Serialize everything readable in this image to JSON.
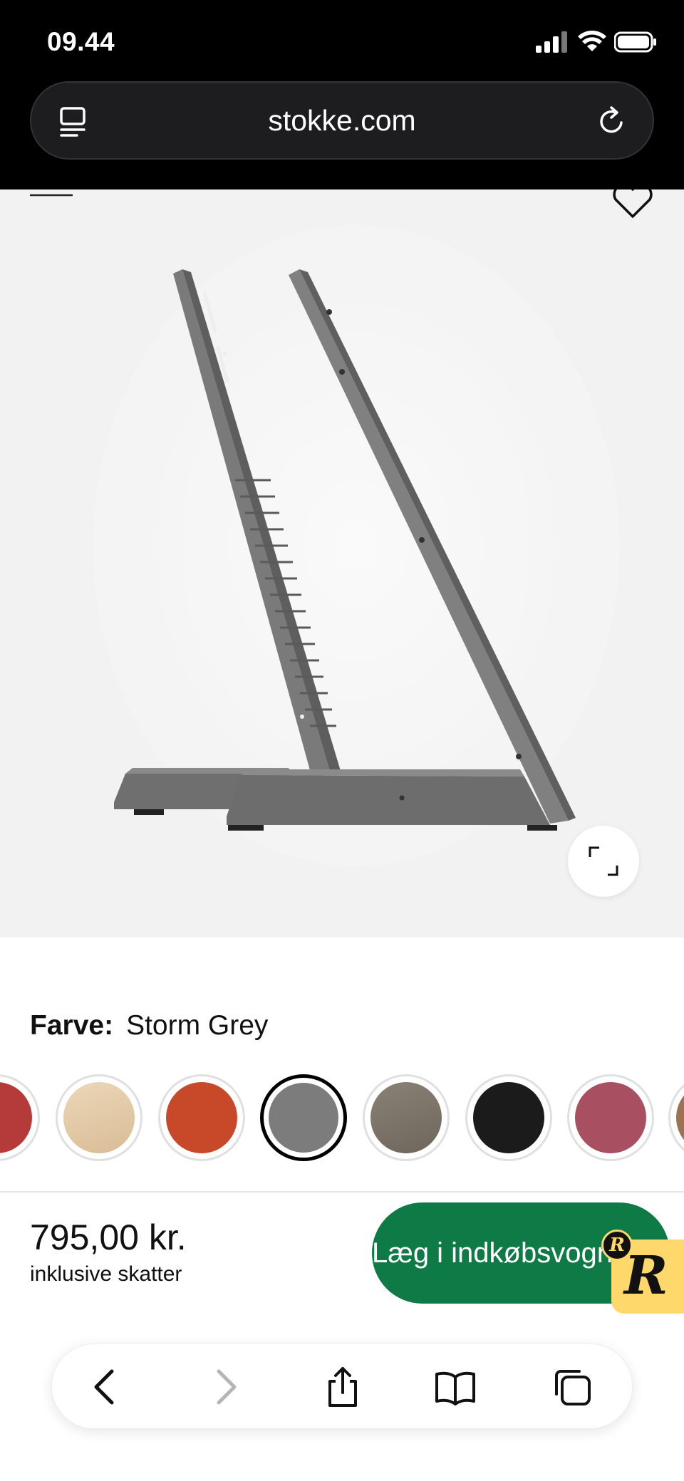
{
  "status_bar": {
    "time": "09.44"
  },
  "browser": {
    "url": "stokke.com"
  },
  "product": {
    "color_label": "Farve:",
    "color_value": "Storm Grey",
    "swatches": [
      {
        "name": "red",
        "color": "#b53a3a"
      },
      {
        "name": "natural",
        "color": "#e3c9a8"
      },
      {
        "name": "orange",
        "color": "#c8482a"
      },
      {
        "name": "storm-grey",
        "color": "#7c7c7c",
        "selected": true
      },
      {
        "name": "hazy-grey",
        "color": "#7d7469"
      },
      {
        "name": "black",
        "color": "#1b1b1b"
      },
      {
        "name": "rose",
        "color": "#a84f62"
      },
      {
        "name": "walnut",
        "color": "#9b7350"
      }
    ],
    "price": "795,00 kr.",
    "tax_note": "inklusive skatter",
    "add_to_cart_label": "Læg i indkøbsvogn"
  },
  "badge": {
    "letter": "R"
  },
  "colors": {
    "cta_green": "#0e7a46",
    "badge_yellow": "#ffd86b"
  }
}
